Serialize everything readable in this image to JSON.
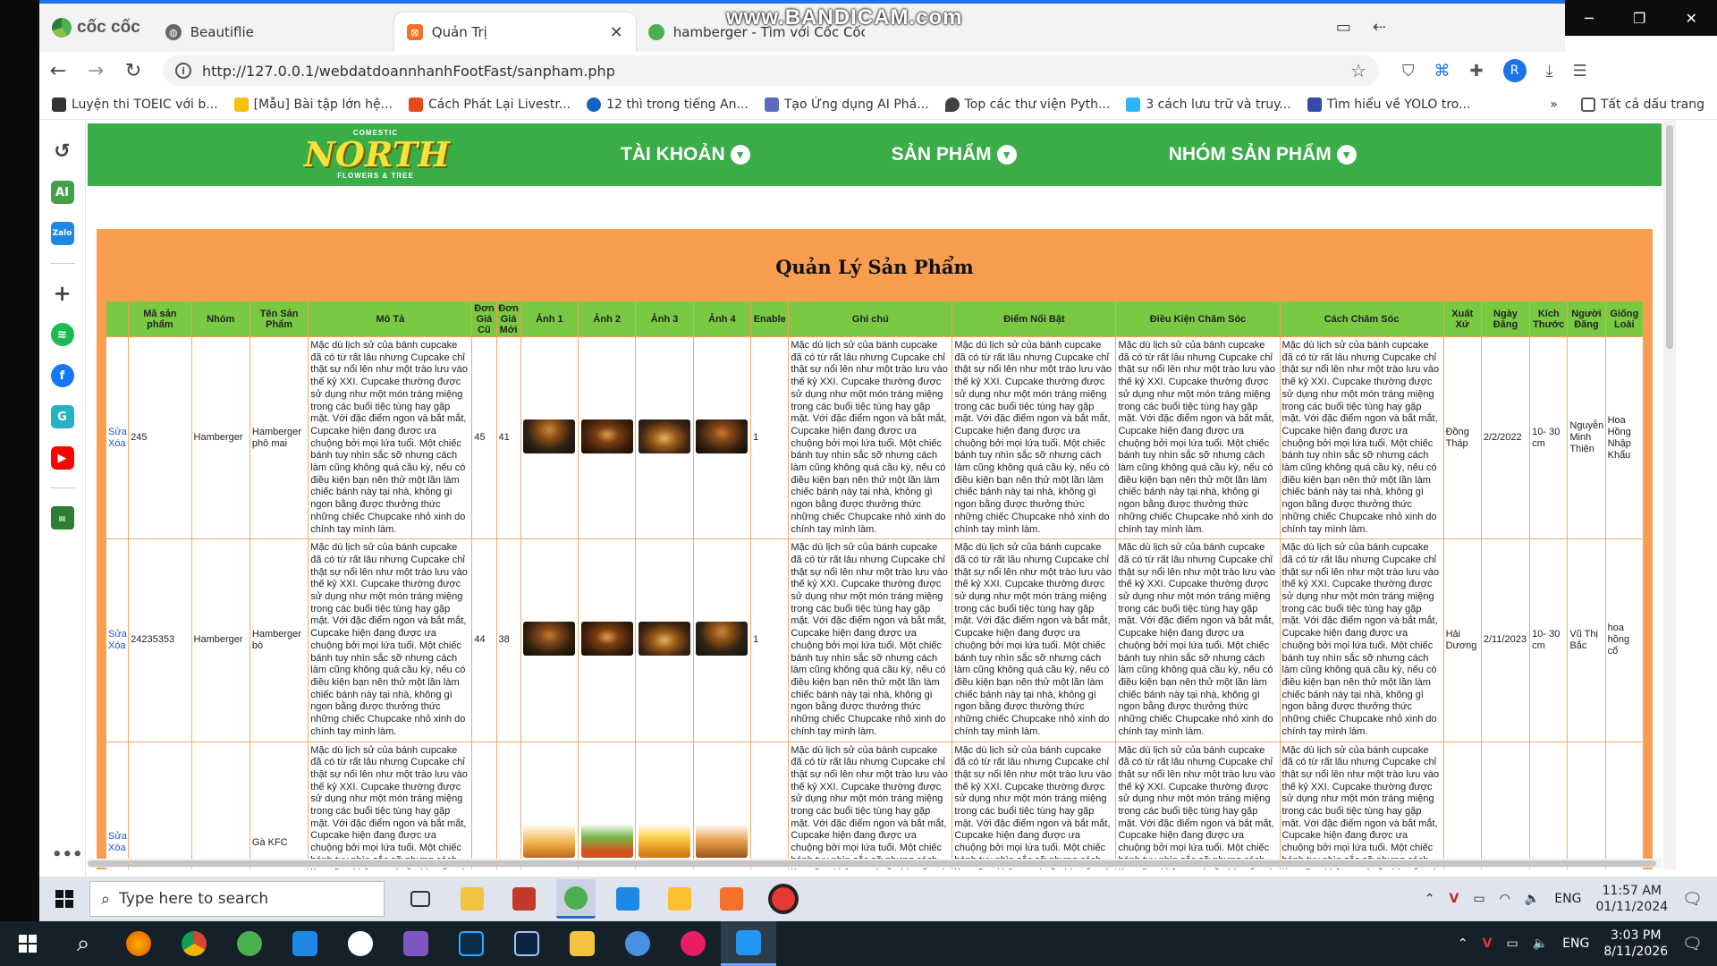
{
  "browser": {
    "brand": "cốc cốc",
    "tabs": [
      {
        "label": "Beautiflie",
        "active": false
      },
      {
        "label": "Quản Trị",
        "active": true
      },
      {
        "label": "hamberger - Tìm với Cốc Cốc",
        "active": false
      }
    ],
    "watermark": "www.BANDICAM.com",
    "url": "http://127.0.0.1/webdatdoannhanhFootFast/sanpham.php",
    "profile_initial": "R",
    "bookmarks": [
      "Luyện thi TOEIC với b...",
      "[Mẫu] Bài tập lớn hệ...",
      "Cách Phát Lại Livestr...",
      "12 thì trong tiếng An...",
      "Tạo Ứng dụng AI Phá...",
      "Top các thư viện Pyth...",
      "3 cách lưu trữ và truy...",
      "Tìm hiểu về YOLO tro..."
    ],
    "all_bookmarks": "Tất cả dấu trang"
  },
  "site": {
    "logo_top": "COMESTIC",
    "logo": "NORTH",
    "logo_bottom": "FLOWERS & TREE",
    "menu": [
      "TÀI KHOẢN",
      "SẢN PHẨM",
      "NHÓM SẢN PHẨM"
    ],
    "page_title": "Quản Lý Sản Phẩm"
  },
  "table": {
    "headers": [
      "",
      "Mã sản phẩm",
      "Nhóm",
      "Tên Sản Phẩm",
      "Mô Tả",
      "Đơn Giá Cũ",
      "Đơn Giá Mới",
      "Ảnh 1",
      "Ảnh 2",
      "Ảnh 3",
      "Ảnh 4",
      "Enable",
      "Ghi chú",
      "Điểm Nổi Bật",
      "Điều Kiện Chăm Sóc",
      "Cách Chăm Sóc",
      "Xuất Xứ",
      "Ngày Đăng",
      "Kích Thước",
      "Người Đăng",
      "Giống Loài"
    ],
    "edit_label": "Sửa",
    "delete_label": "Xóa",
    "long_text": "Mặc dù lịch sử của bánh cupcake đã có từ rất lâu nhưng Cupcake chỉ thật sự nổi lên như một trào lưu vào thế kỷ XXI. Cupcake thường được sử dụng như một món tráng miệng trong các buổi tiệc tùng hay gặp mặt. Với đặc điểm ngon và bắt mắt, Cupcake hiện đang được ưa chuộng bởi mọi lứa tuổi. Một chiếc bánh tuy nhìn sắc sỡ nhưng cách làm cũng không quá cầu kỳ, nếu có điều kiện bạn nên thử một lần làm chiếc bánh này tại nhà, không gì ngon bằng được thưởng thức những chiếc Chupcake nhỏ xinh do chính tay mình làm.",
    "rows": [
      {
        "code": "245",
        "group": "Hamberger",
        "name": "Hamberger phô mai",
        "old_price": "45",
        "new_price": "41",
        "enable": "1",
        "origin": "Đồng Tháp",
        "date": "2/2/2022",
        "size": "10- 30 cm",
        "author": "Nguyễn Minh Thiện",
        "species": "Hoa Hồng Nhập Khẩu"
      },
      {
        "code": "24235353",
        "group": "Hamberger",
        "name": "Hamberger bò",
        "old_price": "44",
        "new_price": "38",
        "enable": "1",
        "origin": "Hải Dương",
        "date": "2/11/2023",
        "size": "10- 30 cm",
        "author": "Vũ Thị Bắc",
        "species": "hoa hồng cổ"
      },
      {
        "code": "",
        "group": "",
        "name": "Gà KFC",
        "old_price": "",
        "new_price": "",
        "enable": "",
        "origin": "",
        "date": "",
        "size": "",
        "author": "",
        "species": ""
      }
    ]
  },
  "taskbar_inner": {
    "search_placeholder": "Type here to search",
    "lang": "ENG",
    "time": "11:57 AM",
    "date": "01/11/2024"
  },
  "taskbar_outer": {
    "lang": "ENG",
    "time": "3:03 PM",
    "date": "8/11/2026"
  }
}
